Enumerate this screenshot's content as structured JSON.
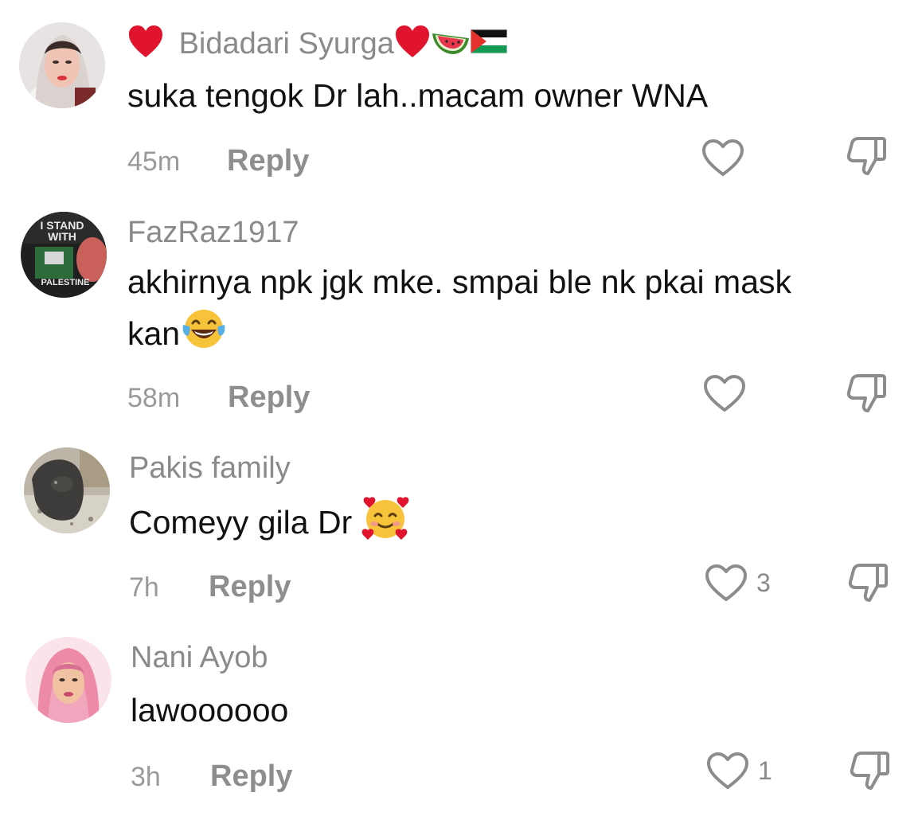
{
  "comments": [
    {
      "username": "Bidadari Syurga",
      "username_emojis": [
        "red-heart",
        "red-heart",
        "watermelon",
        "palestine-flag"
      ],
      "text": "suka tengok Dr lah..macam owner WNA",
      "time": "45m",
      "reply_label": "Reply",
      "likes": ""
    },
    {
      "username": "FazRaz1917",
      "text_line1": "akhirnya npk jgk mke. smpai ble nk pkai mask",
      "text_line2": "kan",
      "text_emoji": "face-with-tears-of-joy",
      "time": "58m",
      "reply_label": "Reply",
      "likes": "",
      "avatar_text": [
        "I STAND",
        "WITH",
        "PALESTINE"
      ]
    },
    {
      "username": "Pakis family",
      "text": "Comeyy gila Dr ",
      "text_emoji": "smiling-face-with-hearts",
      "time": "7h",
      "reply_label": "Reply",
      "likes": "3"
    },
    {
      "username": "Nani Ayob",
      "text": "lawoooooo",
      "time": "3h",
      "reply_label": "Reply",
      "likes": "1"
    }
  ],
  "colors": {
    "text": "#111111",
    "muted": "#8a8a8a",
    "heart": "#e0142c",
    "icon": "#8c8c8c"
  }
}
